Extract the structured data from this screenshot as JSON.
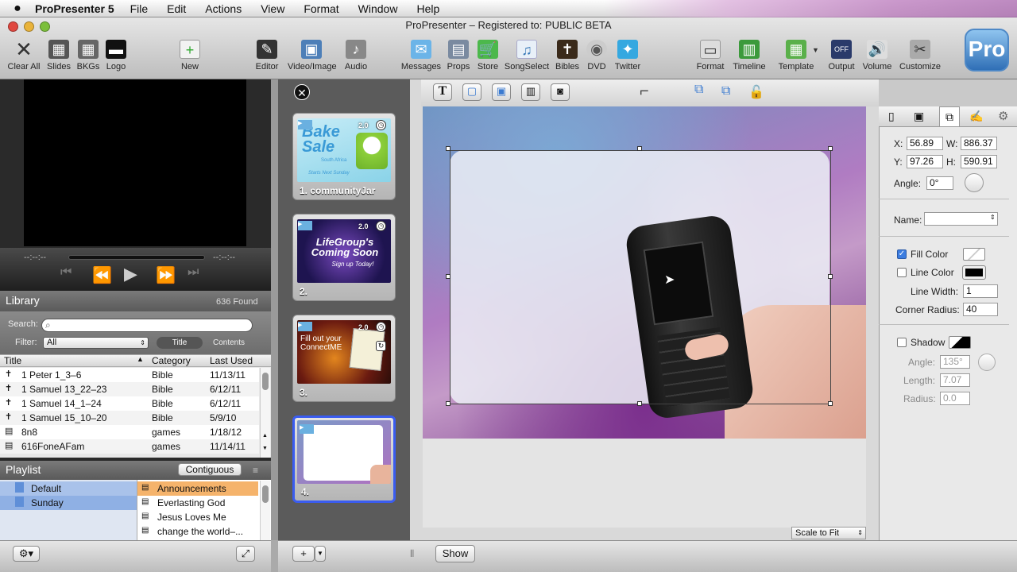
{
  "menubar": {
    "app": "ProPresenter 5",
    "items": [
      "File",
      "Edit",
      "Actions",
      "View",
      "Format",
      "Window",
      "Help"
    ]
  },
  "window": {
    "title": "ProPresenter – Registered to: PUBLIC BETA"
  },
  "toolbar": {
    "clear_all": "Clear All",
    "slides": "Slides",
    "bkgs": "BKGs",
    "logo": "Logo",
    "new": "New",
    "editor": "Editor",
    "video_image": "Video/Image",
    "audio": "Audio",
    "messages": "Messages",
    "props": "Props",
    "store": "Store",
    "songselect": "SongSelect",
    "bibles": "Bibles",
    "dvd": "DVD",
    "twitter": "Twitter",
    "format": "Format",
    "timeline": "Timeline",
    "template": "Template",
    "output": "Output",
    "volume": "Volume",
    "customize": "Customize",
    "pro_logo": "Pro"
  },
  "transport": {
    "elapsed": "--:--:--",
    "remaining": "--:--:--"
  },
  "library": {
    "title": "Library",
    "found": "636 Found",
    "search_label": "Search:",
    "filter_label": "Filter:",
    "filter_value": "All",
    "seg_title": "Title",
    "seg_contents": "Contents",
    "columns": [
      "Title",
      "Category",
      "Last Used"
    ],
    "rows": [
      {
        "title": "1 Peter 1_3–6",
        "category": "Bible",
        "last_used": "11/13/11"
      },
      {
        "title": "1 Samuel 13_22–23",
        "category": "Bible",
        "last_used": "6/12/11"
      },
      {
        "title": "1 Samuel 14_1–24",
        "category": "Bible",
        "last_used": "6/12/11"
      },
      {
        "title": "1 Samuel 15_10–20",
        "category": "Bible",
        "last_used": "5/9/10"
      },
      {
        "title": "8n8",
        "category": "games",
        "last_used": "1/18/12"
      },
      {
        "title": "616FoneAFam",
        "category": "games",
        "last_used": "11/14/11"
      }
    ]
  },
  "playlist": {
    "title": "Playlist",
    "contiguous": "Contiguous",
    "lists": [
      "Default",
      "Sunday"
    ],
    "items": [
      "Announcements",
      "Everlasting God",
      "Jesus Loves Me",
      "change the world–..."
    ]
  },
  "slides": [
    {
      "label": "1. communityJar",
      "time": "2.0",
      "thumb_title": "Bake Sale",
      "thumb_sub": "South Africa",
      "thumb_line": "Starts Next Sunday"
    },
    {
      "label": "2.",
      "time": "2.0",
      "thumb_title": "LifeGroup's Coming Soon",
      "thumb_sub": "Sign up Today!"
    },
    {
      "label": "3.",
      "time": "2.0",
      "thumb_title": "Fill out your ConnectME"
    },
    {
      "label": "4.",
      "time": ""
    }
  ],
  "editor": {
    "scale": "Scale to Fit",
    "show_button": "Show"
  },
  "inspector": {
    "x_label": "X:",
    "x": "56.89",
    "w_label": "W:",
    "w": "886.37",
    "y_label": "Y:",
    "y": "97.26",
    "h_label": "H:",
    "h": "590.91",
    "angle_label": "Angle:",
    "angle": "0°",
    "name_label": "Name:",
    "name": "",
    "fill_color": "Fill Color",
    "line_color": "Line Color",
    "line_width_label": "Line Width:",
    "line_width": "1",
    "corner_radius_label": "Corner Radius:",
    "corner_radius": "40",
    "shadow": "Shadow",
    "shadow_angle_label": "Angle:",
    "shadow_angle": "135°",
    "length_label": "Length:",
    "length": "7.07",
    "radius_label": "Radius:",
    "radius": "0.0"
  },
  "colors": {
    "selection": "#3a5cf0",
    "playlist_highlight": "#f5b36b",
    "accent_blue": "#3c7de0"
  }
}
